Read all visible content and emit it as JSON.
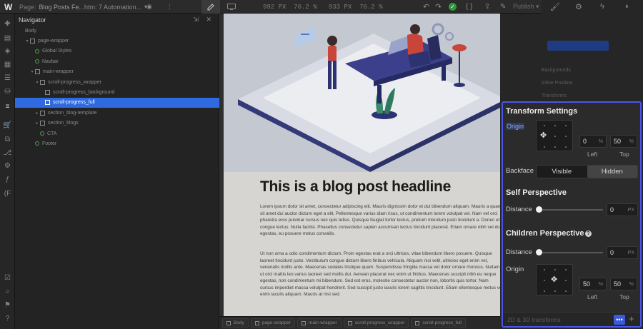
{
  "topbar": {
    "logo": "W",
    "page_key": "Page:",
    "page_value": "Blog Posts Fe...",
    "ruleset": "htm: 7 Automation...",
    "eye": "◉",
    "more": "⋮",
    "dim_w_label": "992",
    "dim_w_unit": "PX",
    "dim_w_pct": "76.2",
    "dim_h_label": "933",
    "dim_h_unit": "PX",
    "dim_h_pct": "76.2",
    "undo": "↶",
    "redo": "↷",
    "check": "✓",
    "code": "{ }",
    "share": "⇪",
    "bell": "✎",
    "publish": "Publish ▾"
  },
  "navigator": {
    "title": "Navigator",
    "tree": [
      {
        "label": "Body",
        "depth": 0,
        "type": "plain",
        "arrow": ""
      },
      {
        "label": "page-wrapper",
        "depth": 1,
        "type": "box",
        "arrow": "▾"
      },
      {
        "label": "Global Styles",
        "depth": 2,
        "type": "component",
        "arrow": ""
      },
      {
        "label": "Navbar",
        "depth": 2,
        "type": "component",
        "arrow": ""
      },
      {
        "label": "main-wrapper",
        "depth": 2,
        "type": "box",
        "arrow": "▾"
      },
      {
        "label": "scroll-progress_wrapper",
        "depth": 3,
        "type": "box",
        "arrow": "▾"
      },
      {
        "label": "scroll-progress_background",
        "depth": 4,
        "type": "box",
        "arrow": ""
      },
      {
        "label": "scroll-progress_full",
        "depth": 4,
        "type": "box",
        "arrow": "",
        "selected": true
      },
      {
        "label": "section_blog-template",
        "depth": 3,
        "type": "box",
        "arrow": "▸"
      },
      {
        "label": "section_blogs",
        "depth": 3,
        "type": "box",
        "arrow": "▸"
      },
      {
        "label": "CTA",
        "depth": 3,
        "type": "component",
        "arrow": ""
      },
      {
        "label": "Footer",
        "depth": 2,
        "type": "component",
        "arrow": ""
      }
    ]
  },
  "canvas": {
    "headline": "This is a blog post headline",
    "paragraph1": "Lorem ipsum dolor sit amet, consectetur adipiscing elit. Mauris dignissim dolor et dui bibendum aliquam. Mauris a quam sit amet dui auctor dictum eget a elit. Pellentesque varius diam risus, ut condimentum lorem volutpat vel. Nam vel orci pharetra eros pulvinar cursus nec quis tellus. Quisque feugiat tortor lectus, pretium interdum justo tincidunt a. Donec et congue lectus. Nulla facilisi. Phasellus consectetur sapien accumsan lectus tincidunt placerat. Etiam ornare nibh vel dui egestas, eu posuere metus convallis.",
    "paragraph2": "Ut non urna a odio condimentum dictum. Proin egestas erat a orci ultrices, vitae bibendum libero posuere. Quisque laoreet tincidunt justo. Vestibulum congue dictum libero finibus vehicula. Aliquam nisi velit, ultricies eget enim vel, venenatis mollis ante. Maecenas sodales tristique quam. Suspendisse fringilla massa vel dolor ornare rhoncus. Nullam ut orci mattis leo varius laoreet sed mollis dui. Aenean placerat nec enim ut finibus. Maecenas suscipit nibh eu neque egestas, non condimentum mi bibendum. Sed est eros, molestie consectetur auctor non, lobortis quis tortor. Nam cursus imperdiet massa volutpat hendrerit. Sed suscipit justo iaculis lorem sagittis tincidunt. Etiam ellentesque metus vel enim iaculis aliquam. Mauris at nisi sed."
  },
  "breadcrumb": [
    "Body",
    "page-wrapper",
    "main-wrapper",
    "scroll-progress_wrapper",
    "scroll-progress_full"
  ],
  "style_panel": {
    "rows": [
      "Backgrounds",
      "Inline Position",
      "Transforms"
    ]
  },
  "transform_settings": {
    "title": "Transform Settings",
    "origin_label": "Origin",
    "origin_left_value": "0",
    "origin_left_unit": "%",
    "origin_top_value": "50",
    "origin_top_unit": "%",
    "left_caption": "Left",
    "top_caption": "Top",
    "backface_label": "Backface",
    "backface_options": [
      "Visible",
      "Hidden"
    ],
    "backface_selected": "Hidden",
    "self_perspective_title": "Self Perspective",
    "self_distance_label": "Distance",
    "self_distance_value": "0",
    "self_distance_unit": "PX",
    "children_perspective_title": "Children Perspective",
    "children_distance_label": "Distance",
    "children_distance_value": "0",
    "children_distance_unit": "PX",
    "children_origin_label": "Origin",
    "children_origin_left_value": "50",
    "children_origin_left_unit": "%",
    "children_origin_top_value": "50",
    "children_origin_top_unit": "%",
    "footer_label": "2D & 3D transforms",
    "more_label": "•••",
    "add_label": "+"
  }
}
